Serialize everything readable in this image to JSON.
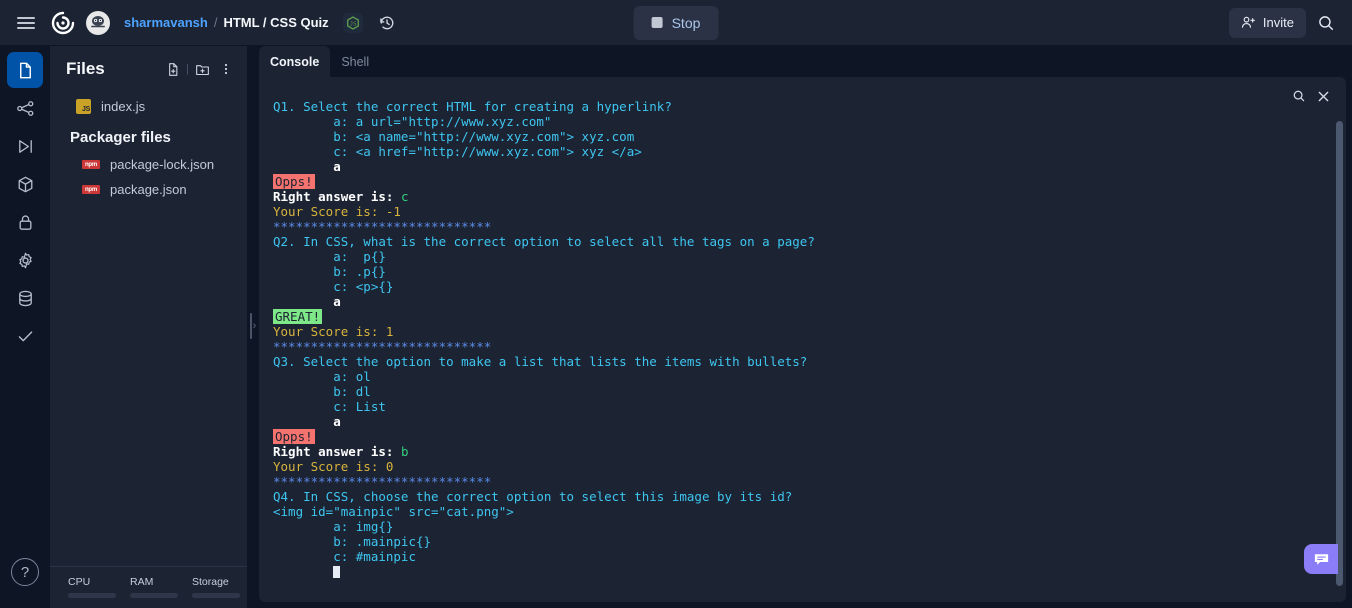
{
  "topbar": {
    "menu_icon": "hamburger-icon",
    "logo_icon": "replit-logo-icon",
    "avatar_icon": "user-avatar",
    "username": "sharmavansh",
    "separator": "/",
    "project_title": "HTML / CSS Quiz",
    "runtime_badge": "nodejs-icon",
    "history_icon": "history-icon",
    "stop_label": "Stop",
    "invite_label": "Invite",
    "invite_icon": "add-person-icon",
    "search_icon": "search-icon"
  },
  "rail": {
    "items": [
      {
        "name": "files",
        "icon": "file-icon",
        "active": true
      },
      {
        "name": "version-control",
        "icon": "git-branch-icon",
        "active": false
      },
      {
        "name": "run",
        "icon": "play-icon",
        "active": false
      },
      {
        "name": "packages",
        "icon": "cube-icon",
        "active": false
      },
      {
        "name": "secrets",
        "icon": "lock-icon",
        "active": false
      },
      {
        "name": "settings",
        "icon": "gear-icon",
        "active": false
      },
      {
        "name": "database",
        "icon": "database-icon",
        "active": false
      },
      {
        "name": "tests",
        "icon": "check-icon",
        "active": false
      }
    ],
    "help_label": "?"
  },
  "files": {
    "title": "Files",
    "new_file_icon": "new-file-icon",
    "new_folder_icon": "new-folder-icon",
    "more_icon": "more-vertical-icon",
    "entries": [
      {
        "name": "index.js",
        "icon": "js-file-icon",
        "badge": "JS"
      }
    ],
    "packager_heading": "Packager files",
    "packager_entries": [
      {
        "name": "package-lock.json",
        "icon": "npm-file-icon",
        "badge": "npm"
      },
      {
        "name": "package.json",
        "icon": "npm-file-icon",
        "badge": "npm"
      }
    ]
  },
  "resources": {
    "cpu_label": "CPU",
    "ram_label": "RAM",
    "storage_label": "Storage",
    "collapse_icon": "chevron-up-icon"
  },
  "console": {
    "tabs": [
      {
        "label": "Console",
        "active": true
      },
      {
        "label": "Shell",
        "active": false
      }
    ],
    "search_icon": "search-icon",
    "close_icon": "close-icon",
    "chat_icon": "chat-icon",
    "lines": [
      {
        "segments": [
          {
            "t": "Q1. Select the correct HTML for creating a hyperlink?",
            "c": "c-q"
          }
        ]
      },
      {
        "segments": [
          {
            "t": "        a: a url=\"http://www.xyz.com\"",
            "c": "c-opt"
          }
        ]
      },
      {
        "segments": [
          {
            "t": "        b: <a name=\"http://www.xyz.com\"> xyz.com",
            "c": "c-opt"
          }
        ]
      },
      {
        "segments": [
          {
            "t": "        c: <a href=\"http://www.xyz.com\"> xyz </a>",
            "c": "c-opt"
          }
        ]
      },
      {
        "segments": [
          {
            "t": "        a",
            "c": "c-ans"
          }
        ]
      },
      {
        "segments": [
          {
            "t": "Opps!",
            "c": "c-bad"
          }
        ]
      },
      {
        "segments": [
          {
            "t": "Right answer is: ",
            "c": "c-label"
          },
          {
            "t": "c",
            "c": "c-right"
          }
        ]
      },
      {
        "segments": [
          {
            "t": "Your Score is: -1",
            "c": "c-score"
          }
        ]
      },
      {
        "segments": [
          {
            "t": "*****************************",
            "c": "c-stars"
          }
        ]
      },
      {
        "segments": [
          {
            "t": "Q2. In CSS, what is the correct option to select all the tags on a page?",
            "c": "c-q"
          }
        ]
      },
      {
        "segments": [
          {
            "t": "        a:  p{}",
            "c": "c-opt"
          }
        ]
      },
      {
        "segments": [
          {
            "t": "        b: .p{}",
            "c": "c-opt"
          }
        ]
      },
      {
        "segments": [
          {
            "t": "        c: <p>{}",
            "c": "c-opt"
          }
        ]
      },
      {
        "segments": [
          {
            "t": "        a",
            "c": "c-ans"
          }
        ]
      },
      {
        "segments": [
          {
            "t": "GREAT!",
            "c": "c-good"
          }
        ]
      },
      {
        "segments": [
          {
            "t": "Your Score is: 1",
            "c": "c-score"
          }
        ]
      },
      {
        "segments": [
          {
            "t": "*****************************",
            "c": "c-stars"
          }
        ]
      },
      {
        "segments": [
          {
            "t": "Q3. Select the option to make a list that lists the items with bullets?",
            "c": "c-q"
          }
        ]
      },
      {
        "segments": [
          {
            "t": "        a: ol",
            "c": "c-opt"
          }
        ]
      },
      {
        "segments": [
          {
            "t": "        b: dl",
            "c": "c-opt"
          }
        ]
      },
      {
        "segments": [
          {
            "t": "        c: List",
            "c": "c-opt"
          }
        ]
      },
      {
        "segments": [
          {
            "t": "        a",
            "c": "c-ans"
          }
        ]
      },
      {
        "segments": [
          {
            "t": "Opps!",
            "c": "c-bad"
          }
        ]
      },
      {
        "segments": [
          {
            "t": "Right answer is: ",
            "c": "c-label"
          },
          {
            "t": "b",
            "c": "c-right"
          }
        ]
      },
      {
        "segments": [
          {
            "t": "Your Score is: 0",
            "c": "c-score"
          }
        ]
      },
      {
        "segments": [
          {
            "t": "*****************************",
            "c": "c-stars"
          }
        ]
      },
      {
        "segments": [
          {
            "t": "Q4. In CSS, choose the correct option to select this image by its id?",
            "c": "c-q"
          }
        ]
      },
      {
        "segments": [
          {
            "t": "<img id=\"mainpic\" src=\"cat.png\">",
            "c": "c-q"
          }
        ]
      },
      {
        "segments": [
          {
            "t": "",
            "c": "c-q"
          }
        ]
      },
      {
        "segments": [
          {
            "t": "        a: img{}",
            "c": "c-opt"
          }
        ]
      },
      {
        "segments": [
          {
            "t": "        b: .mainpic{}",
            "c": "c-opt"
          }
        ]
      },
      {
        "segments": [
          {
            "t": "        c: #mainpic",
            "c": "c-opt"
          }
        ]
      },
      {
        "segments": [
          {
            "t": "        ",
            "c": "c-opt"
          },
          {
            "t": "",
            "c": "cursor"
          }
        ]
      }
    ]
  },
  "colors": {
    "bg": "#0e1525",
    "panel": "#1c2333",
    "accent_blue": "#0053a6",
    "link_blue": "#4da3ff",
    "console_cyan": "#3ec6f0",
    "score_yellow": "#d8b33c",
    "correct_green": "#35d07f",
    "bad_bg": "#f4736e",
    "good_bg": "#7ee787",
    "chat_purple": "#8b7cf8"
  }
}
